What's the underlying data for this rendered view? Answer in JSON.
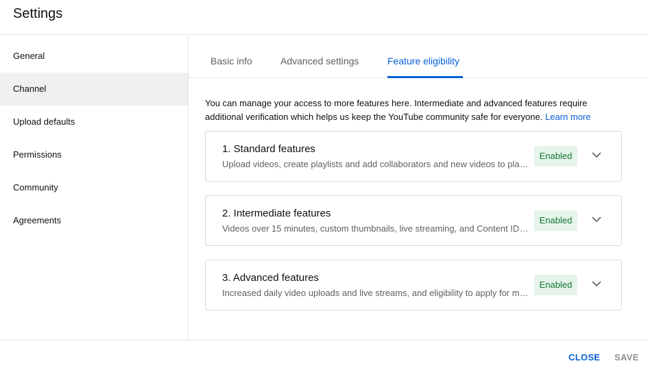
{
  "header": {
    "title": "Settings"
  },
  "sidebar": {
    "items": [
      {
        "label": "General"
      },
      {
        "label": "Channel"
      },
      {
        "label": "Upload defaults"
      },
      {
        "label": "Permissions"
      },
      {
        "label": "Community"
      },
      {
        "label": "Agreements"
      }
    ],
    "selected": "Channel"
  },
  "tabs": {
    "items": [
      {
        "label": "Basic info"
      },
      {
        "label": "Advanced settings"
      },
      {
        "label": "Feature eligibility"
      }
    ],
    "selected": "Feature eligibility"
  },
  "main": {
    "intro_text": "You can manage your access to more features here. Intermediate and advanced features require additional verification which helps us keep the YouTube community safe for everyone.",
    "learn_more": "Learn more",
    "features": [
      {
        "title": "1. Standard features",
        "description": "Upload videos, create playlists and add collaborators and new videos to playlists",
        "status": "Enabled",
        "icon": "chevron-down-icon"
      },
      {
        "title": "2. Intermediate features",
        "description": "Videos over 15 minutes, custom thumbnails, live streaming, and Content ID appeals",
        "status": "Enabled",
        "icon": "chevron-down-icon"
      },
      {
        "title": "3. Advanced features",
        "description": "Increased daily video uploads and live streams, and eligibility to apply for monetization",
        "status": "Enabled",
        "icon": "chevron-down-icon"
      }
    ]
  },
  "footer": {
    "close_label": "CLOSE",
    "save_label": "SAVE"
  },
  "colors": {
    "accent": "#065fd4",
    "enabled_bg": "#e6f4ea",
    "enabled_text": "#137333",
    "selected_row": "#f0f0f0"
  }
}
